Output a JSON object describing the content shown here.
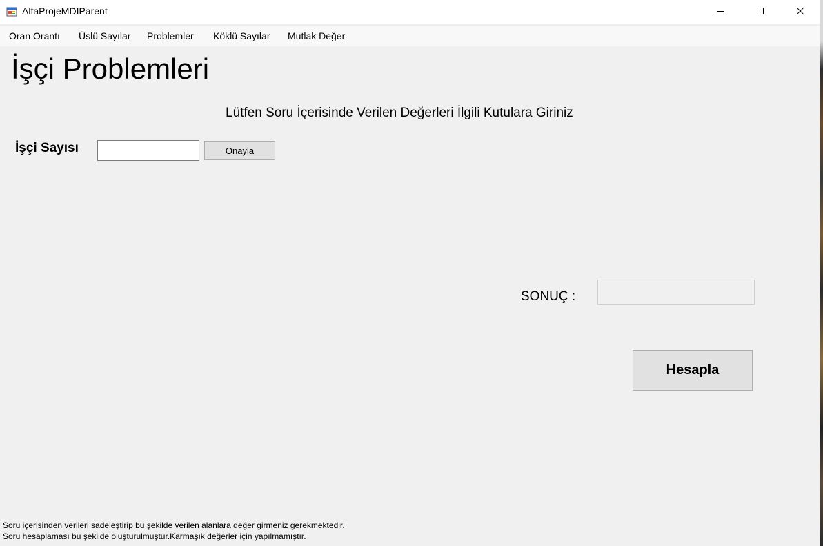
{
  "window": {
    "title": "AlfaProjeMDIParent",
    "controls": {
      "minimize_icon": "minimize-icon",
      "maximize_icon": "maximize-icon",
      "close_icon": "close-icon"
    }
  },
  "menu": {
    "items": [
      {
        "label": "Oran Orantı"
      },
      {
        "label": "Üslü Sayılar"
      },
      {
        "label": "Problemler"
      },
      {
        "label": "Köklü Sayılar"
      },
      {
        "label": "Mutlak Değer"
      }
    ]
  },
  "form": {
    "title": "İşçi Problemleri",
    "instruction": "Lütfen Soru İçerisinde Verilen Değerleri İlgili Kutulara Giriniz",
    "isci_sayisi_label": "İşçi Sayısı",
    "isci_sayisi_value": "",
    "onayla_label": "Onayla",
    "sonuc_label": "SONUÇ :",
    "sonuc_value": "",
    "hesapla_label": "Hesapla",
    "notes": [
      "Soru içerisinden verileri sadeleştirip bu şekilde verilen alanlara değer girmeniz gerekmektedir.",
      "Soru hesaplaması bu şekilde oluşturulmuştur.Karmaşık değerler için yapılmamıştır."
    ]
  },
  "colors": {
    "form_background": "#f0f0f0",
    "titlebar_background": "#ffffff",
    "button_background": "#e1e1e1"
  }
}
